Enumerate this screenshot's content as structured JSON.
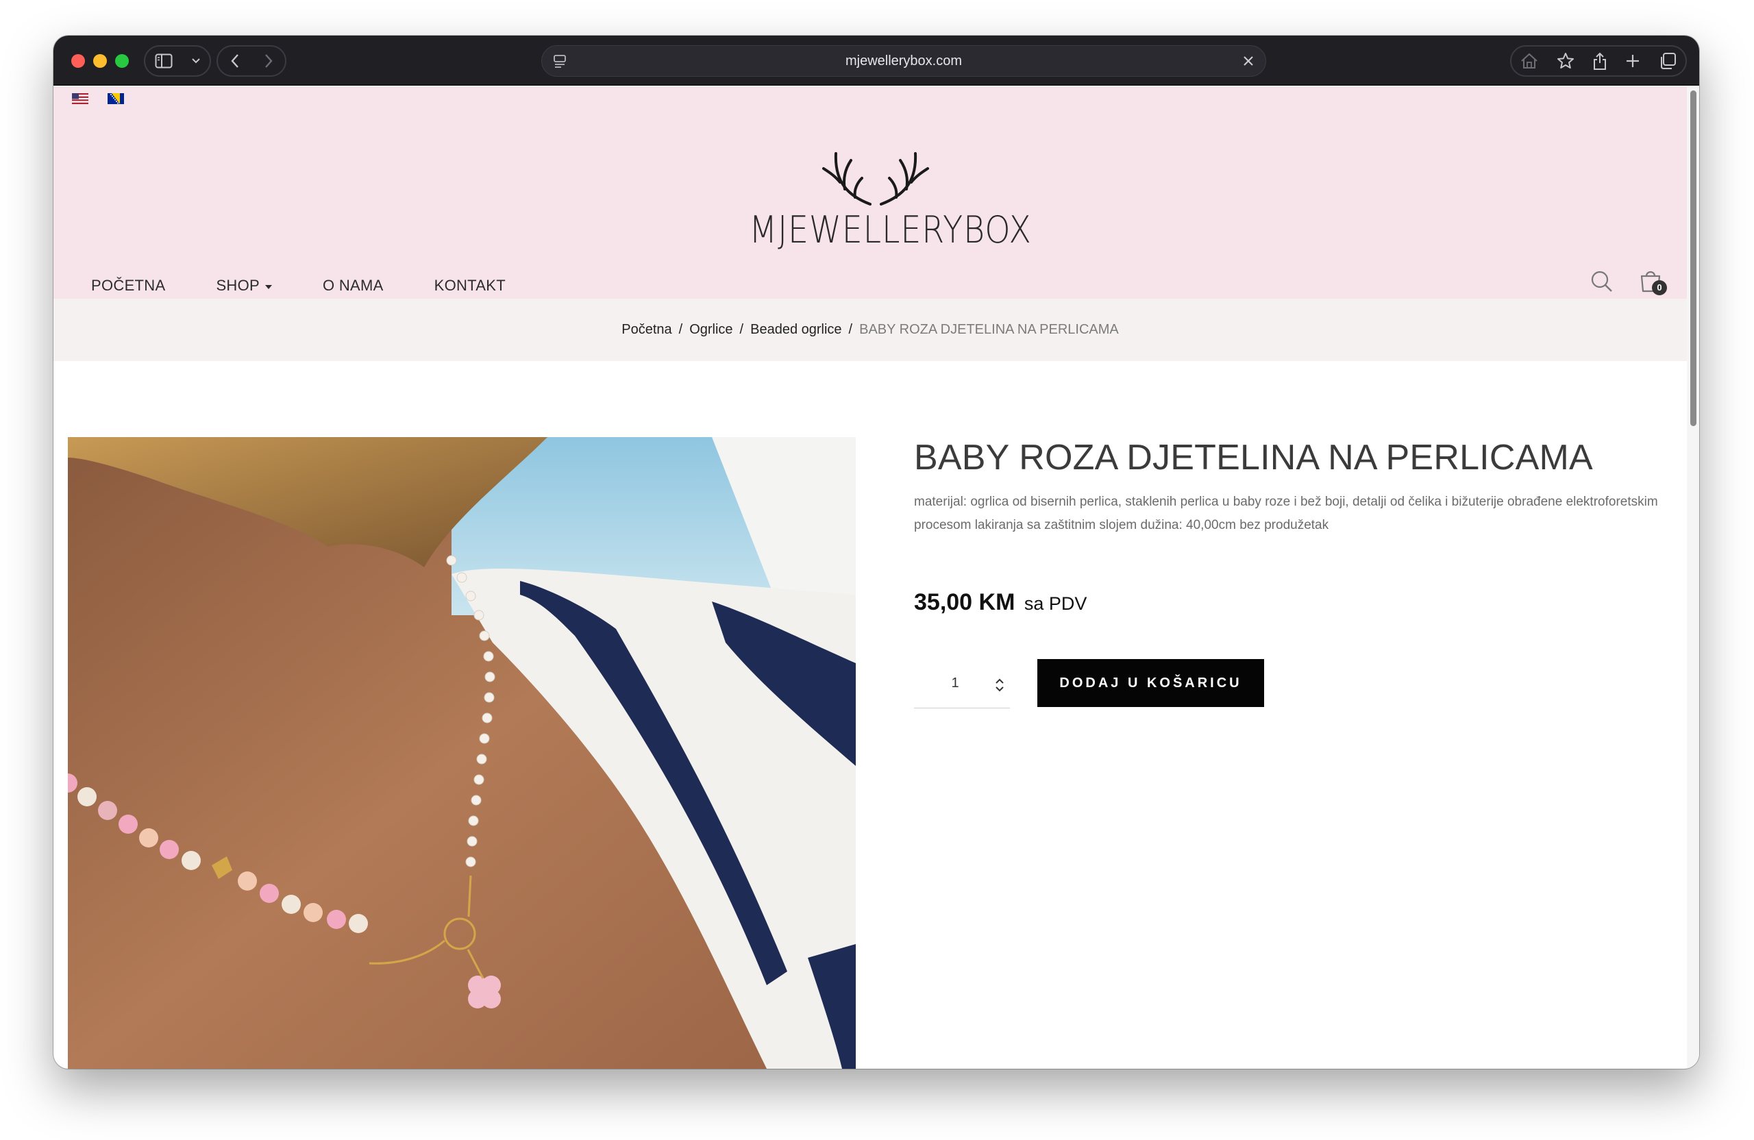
{
  "browser": {
    "url": "mjewellerybox.com"
  },
  "site": {
    "flags": [
      "us-flag",
      "ba-flag"
    ],
    "logo_text": "MJEWELLERYBOX",
    "nav": [
      {
        "label": "POČETNA"
      },
      {
        "label": "SHOP",
        "has_dropdown": true
      },
      {
        "label": "O NAMA"
      },
      {
        "label": "KONTAKT"
      }
    ],
    "cart_count": "0"
  },
  "breadcrumb": {
    "items": [
      "Početna",
      "Ogrlice",
      "Beaded ogrlice"
    ],
    "current": "BABY ROZA DJETELINA NA PERLICAMA",
    "separator": "/"
  },
  "product": {
    "title": "BABY ROZA DJETELINA NA PERLICAMA",
    "description": "materijal: ogrlica od bisernih perlica, staklenih perlica u baby roze i bež boji, detalji od čelika i bižuterije obrađene elektroforetskim procesom lakiranja sa zaštitnim slojem dužina: 40,00cm bez produžetak",
    "price": "35,00 KM",
    "price_suffix": "sa PDV",
    "quantity": "1",
    "add_to_cart_label": "DODAJ U KOŠARICU"
  },
  "colors": {
    "header_bg": "#f7e3ea",
    "breadcrumb_bg": "#f6f1f1",
    "button_bg": "#050505"
  }
}
